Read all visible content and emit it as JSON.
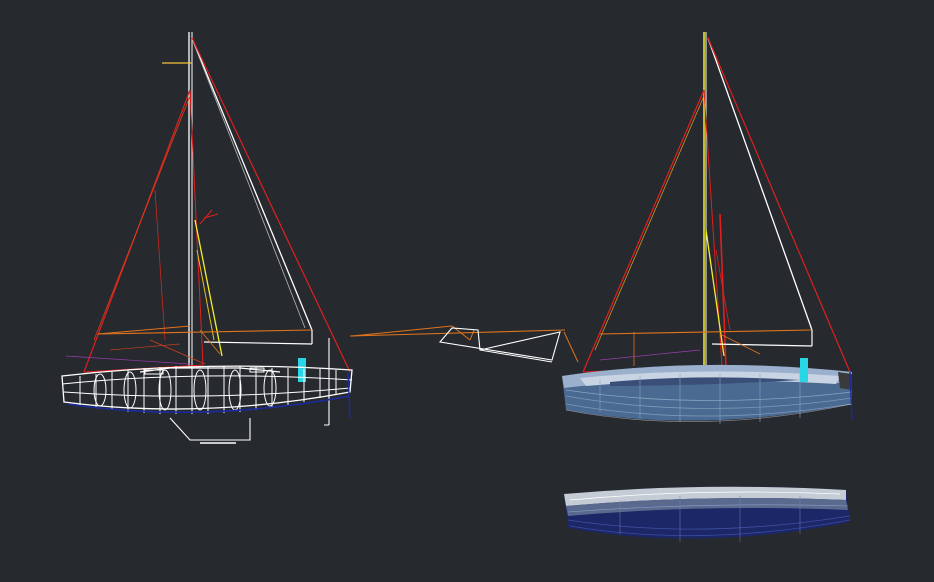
{
  "canvas": {
    "background": "#26292e",
    "description_visible_text": []
  },
  "colors": {
    "wireframe": "#ffffff",
    "rigging": "#e0201e",
    "boom_and_spars": "#e0741e",
    "mast_highlight": "#f5f02a",
    "fender": "#29d6e6",
    "keel_line": "#1c2aa0",
    "hull_shaded": "#4a6a92",
    "hull_deck": "#c8d4e4",
    "hull_bottom_dark": "#1b2766"
  },
  "views": [
    {
      "id": "wireframe-side-view"
    },
    {
      "id": "loose-boom-and-sail-parts"
    },
    {
      "id": "shaded-side-view"
    },
    {
      "id": "shaded-hull-profile"
    }
  ]
}
